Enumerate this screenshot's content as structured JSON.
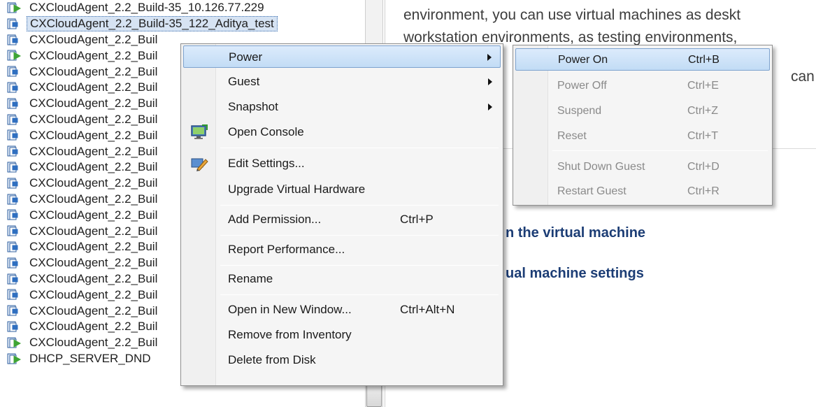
{
  "tree": {
    "items": [
      {
        "label": "CXCloudAgent_2.2_Build-35_10.126.77.229",
        "state": "powered-on"
      },
      {
        "label": "CXCloudAgent_2.2_Build-35_122_Aditya_test",
        "state": "powered-off",
        "selected": true
      },
      {
        "label": "CXCloudAgent_2.2_Buil",
        "state": "powered-off"
      },
      {
        "label": "CXCloudAgent_2.2_Buil",
        "state": "powered-on"
      },
      {
        "label": "CXCloudAgent_2.2_Buil",
        "state": "powered-off"
      },
      {
        "label": "CXCloudAgent_2.2_Buil",
        "state": "powered-off"
      },
      {
        "label": "CXCloudAgent_2.2_Buil",
        "state": "powered-off"
      },
      {
        "label": "CXCloudAgent_2.2_Buil",
        "state": "powered-off"
      },
      {
        "label": "CXCloudAgent_2.2_Buil",
        "state": "powered-off"
      },
      {
        "label": "CXCloudAgent_2.2_Buil",
        "state": "powered-off"
      },
      {
        "label": "CXCloudAgent_2.2_Buil",
        "state": "powered-off"
      },
      {
        "label": "CXCloudAgent_2.2_Buil",
        "state": "powered-off"
      },
      {
        "label": "CXCloudAgent_2.2_Buil",
        "state": "powered-off"
      },
      {
        "label": "CXCloudAgent_2.2_Buil",
        "state": "powered-off"
      },
      {
        "label": "CXCloudAgent_2.2_Buil",
        "state": "powered-off"
      },
      {
        "label": "CXCloudAgent_2.2_Buil",
        "state": "powered-off"
      },
      {
        "label": "CXCloudAgent_2.2_Buil",
        "state": "powered-off"
      },
      {
        "label": "CXCloudAgent_2.2_Buil",
        "state": "powered-off"
      },
      {
        "label": "CXCloudAgent_2.2_Buil",
        "state": "powered-off"
      },
      {
        "label": "CXCloudAgent_2.2_Buil",
        "state": "powered-off"
      },
      {
        "label": "CXCloudAgent_2.2_Buil",
        "state": "powered-off"
      },
      {
        "label": "CXCloudAgent_2.2_Buil",
        "state": "powered-on"
      },
      {
        "label": "DHCP_SERVER_DND",
        "state": "powered-on"
      }
    ]
  },
  "summary": {
    "line1": "environment, you can use virtual machines as deskt",
    "line2": "workstation environments, as testing environments, ",
    "line3": "can n",
    "link1": "n the virtual machine",
    "link2": "ual machine settings"
  },
  "context_menu": {
    "items": {
      "power": {
        "label": "Power"
      },
      "guest": {
        "label": "Guest"
      },
      "snapshot": {
        "label": "Snapshot"
      },
      "open_console": {
        "label": "Open Console"
      },
      "edit_settings": {
        "label": "Edit Settings..."
      },
      "upgrade_hw": {
        "label": "Upgrade Virtual Hardware"
      },
      "add_permission": {
        "label": "Add Permission...",
        "shortcut": "Ctrl+P"
      },
      "report_performance": {
        "label": "Report Performance..."
      },
      "rename": {
        "label": "Rename"
      },
      "open_new_window": {
        "label": "Open in New Window...",
        "shortcut": "Ctrl+Alt+N"
      },
      "remove_inventory": {
        "label": "Remove from Inventory"
      },
      "delete_disk": {
        "label": "Delete from Disk"
      }
    },
    "icons": {
      "open_console": "console-icon",
      "edit_settings": "edit-settings-icon"
    }
  },
  "power_submenu": {
    "items": {
      "power_on": {
        "label": "Power On",
        "shortcut": "Ctrl+B",
        "enabled": true
      },
      "power_off": {
        "label": "Power Off",
        "shortcut": "Ctrl+E",
        "enabled": false
      },
      "suspend": {
        "label": "Suspend",
        "shortcut": "Ctrl+Z",
        "enabled": false
      },
      "reset": {
        "label": "Reset",
        "shortcut": "Ctrl+T",
        "enabled": false
      },
      "shutdown_guest": {
        "label": "Shut Down Guest",
        "shortcut": "Ctrl+D",
        "enabled": false
      },
      "restart_guest": {
        "label": "Restart Guest",
        "shortcut": "Ctrl+R",
        "enabled": false
      }
    }
  },
  "colors": {
    "vm_on_green": "#3fa535",
    "vm_off_blue": "#2f6fc0",
    "highlight": "#c2dcf5",
    "link_blue": "#1c3d75"
  }
}
